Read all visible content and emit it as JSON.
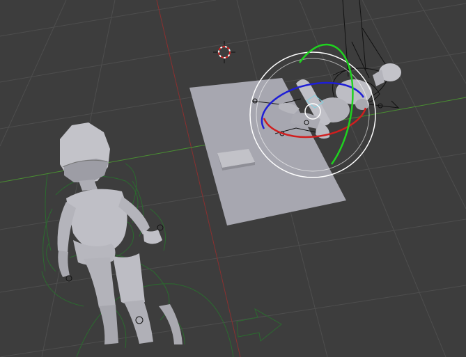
{
  "viewport": {
    "view": "3D Viewport",
    "background_color": "#3d3d3d",
    "grid_color": "#4e4e4e",
    "x_axis_color": "#8a3030",
    "y_axis_color": "#4a8f32"
  },
  "scene": {
    "objects": [
      {
        "name": "plane",
        "type": "mesh",
        "color": "#a7a7b0"
      },
      {
        "name": "box",
        "type": "mesh",
        "color": "#b9b9c0"
      },
      {
        "name": "mannequin-front",
        "type": "mesh",
        "color": "#c3c3c9",
        "rig_color": "#2b6b2f"
      },
      {
        "name": "mannequin-lying",
        "type": "mesh",
        "color": "#c3c3c9",
        "rig_color": "#111111",
        "selected": true
      }
    ],
    "cursor_icon": "3d-cursor-icon",
    "rotate_gizmo_icon": "rotate-gizmo-icon",
    "gizmo_colors": {
      "x": "#d11e1e",
      "y": "#1fd31f",
      "z": "#1e1ed6",
      "view": "#ffffff"
    }
  }
}
